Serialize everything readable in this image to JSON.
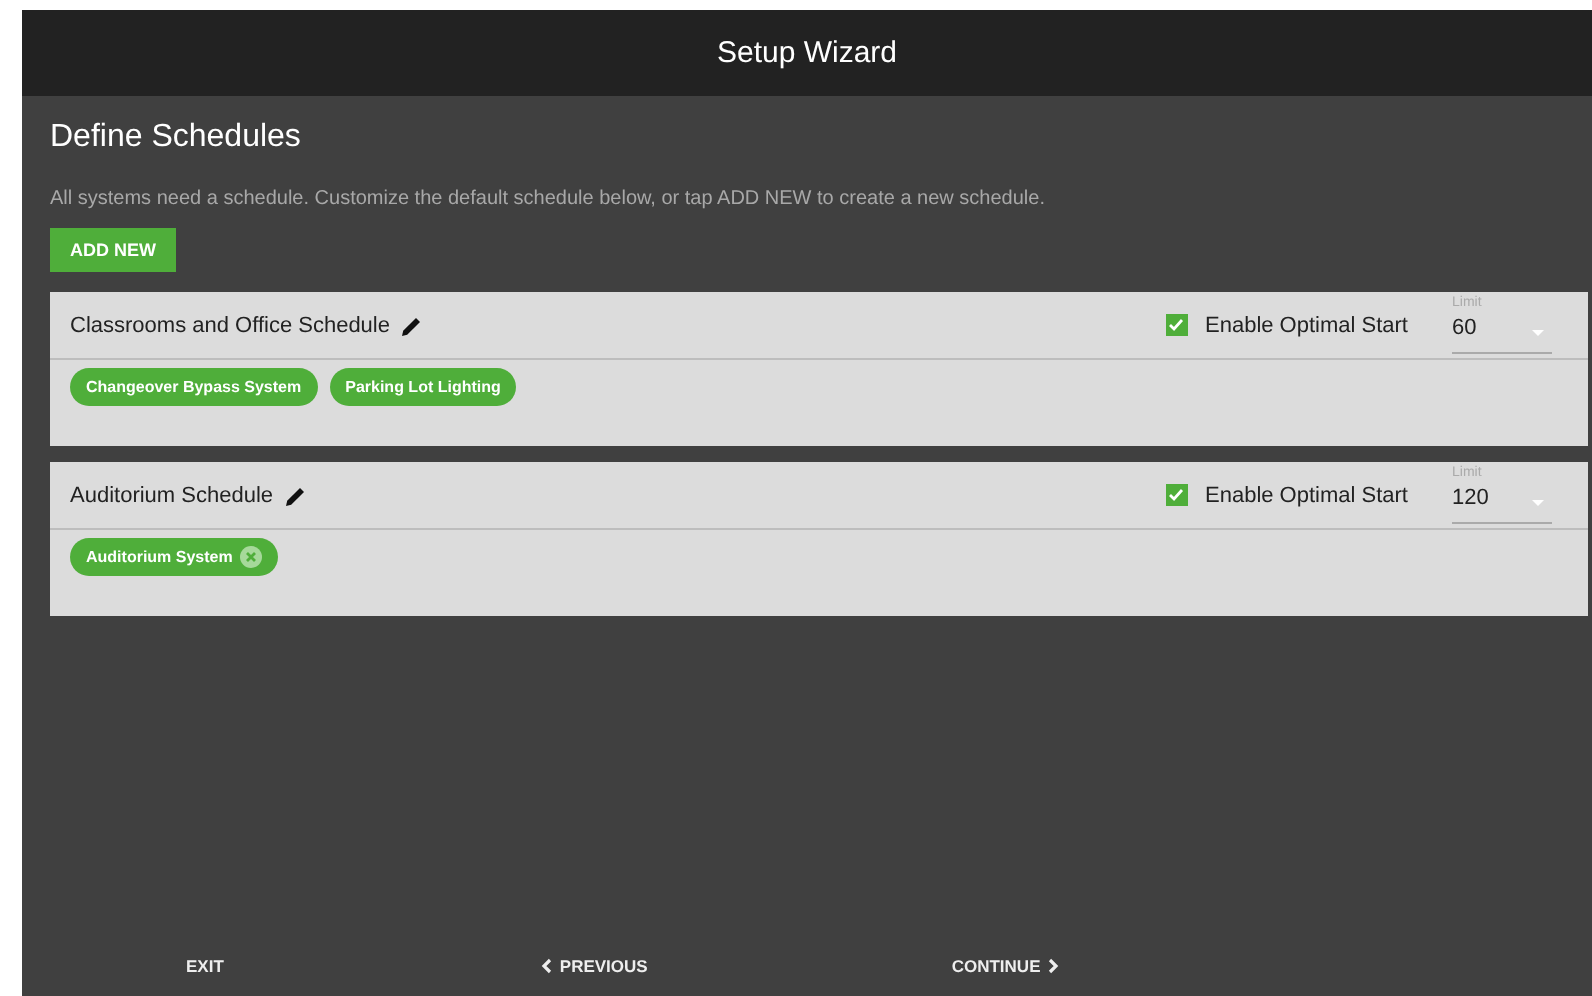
{
  "window": {
    "title": "Setup Wizard"
  },
  "heading": "Define Schedules",
  "description": "All systems need a schedule. Customize the default schedule below, or tap ADD NEW to create a new schedule.",
  "add_button": "ADD NEW",
  "schedules": [
    {
      "name": "Classrooms and Office Schedule",
      "optimal_start": {
        "label": "Enable Optimal Start",
        "checked": true
      },
      "limit": {
        "label": "Limit",
        "value": "60"
      },
      "systems": [
        {
          "name": "Changeover Bypass System",
          "removable": false
        },
        {
          "name": "Parking Lot Lighting",
          "removable": false
        }
      ]
    },
    {
      "name": "Auditorium Schedule",
      "optimal_start": {
        "label": "Enable Optimal Start",
        "checked": true
      },
      "limit": {
        "label": "Limit",
        "value": "120"
      },
      "systems": [
        {
          "name": "Auditorium System",
          "removable": true
        }
      ]
    }
  ],
  "footer": [
    {
      "label": "EXIT",
      "kind": "plain"
    },
    {
      "label": "PREVIOUS",
      "kind": "back"
    },
    {
      "label": "CONTINUE",
      "kind": "forward"
    }
  ]
}
